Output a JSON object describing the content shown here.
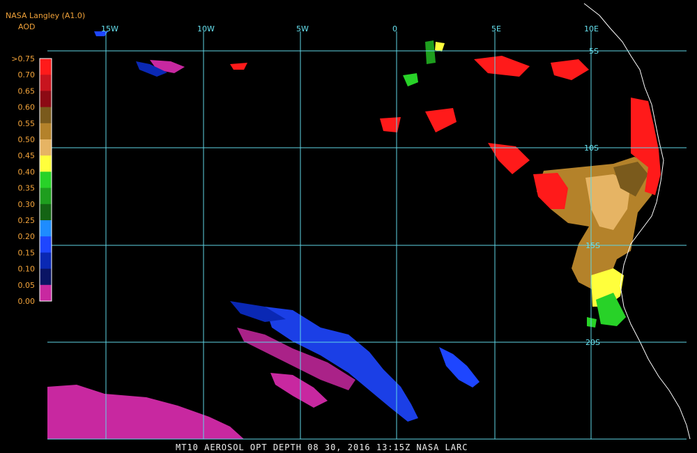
{
  "header": {
    "source": "NASA Langley (A1.0)",
    "product": "AOD"
  },
  "footer": {
    "caption": "MT10  AEROSOL OPT DEPTH   08 30, 2016 13:15Z   NASA LARC"
  },
  "grid": {
    "lon_labels": [
      "15W",
      "10W",
      "5W",
      "0",
      "5E",
      "10E"
    ],
    "lat_labels": [
      "5S",
      "10S",
      "15S",
      "20S"
    ]
  },
  "color_scale": {
    "labels": [
      ">0.75",
      "0.70",
      "0.65",
      "0.60",
      "0.55",
      "0.50",
      "0.45",
      "0.40",
      "0.35",
      "0.30",
      "0.25",
      "0.20",
      "0.15",
      "0.10",
      "0.05",
      "0.00"
    ],
    "colors": [
      "#ff1a1a",
      "#c8141e",
      "#8c0a14",
      "#7a5a1c",
      "#b4822a",
      "#e6b464",
      "#ffff3c",
      "#28d228",
      "#1e9e1e",
      "#146414",
      "#1e8cff",
      "#1e46ff",
      "#0a28b4",
      "#0a1464",
      "#c828a0"
    ]
  },
  "colors": {
    "grid": "#5fd6e6",
    "coast": "#ffffff",
    "background": "#000000"
  }
}
